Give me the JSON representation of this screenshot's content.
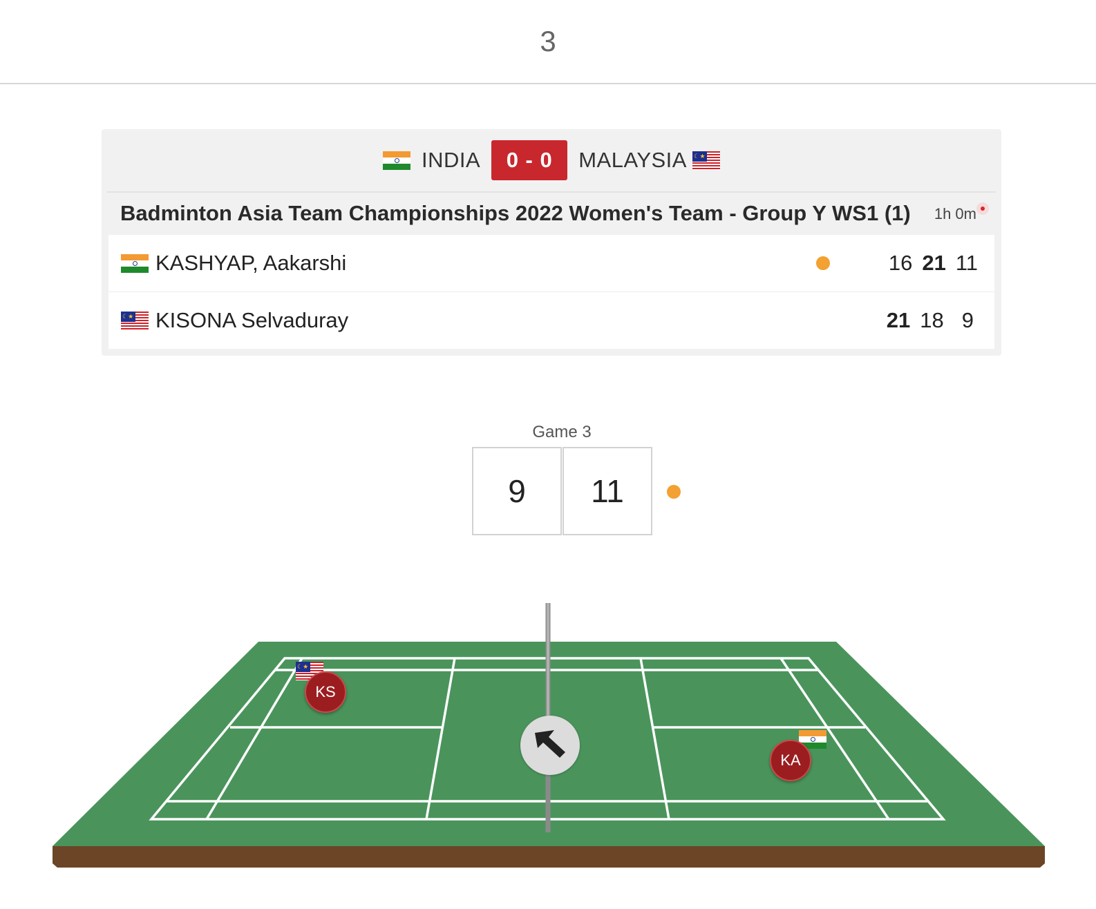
{
  "page": {
    "heading": "3"
  },
  "tie": {
    "team_left": "INDIA",
    "team_right": "MALAYSIA",
    "tie_score": "0 - 0",
    "team_left_flag": "flag-india-icon",
    "team_right_flag": "flag-malaysia-icon"
  },
  "match": {
    "title": "Badminton Asia Team Championships 2022 Women's Team - Group Y WS1 (1)",
    "duration": "1h 0m",
    "live_indicator": "live-dot-icon",
    "players": [
      {
        "name": "KASHYAP, Aakarshi",
        "flag": "flag-india-icon",
        "serving": true,
        "games": [
          "16",
          "21",
          "11"
        ],
        "games_won": [
          false,
          true,
          false
        ]
      },
      {
        "name": "KISONA Selvaduray",
        "flag": "flag-malaysia-icon",
        "serving": false,
        "games": [
          "21",
          "18",
          "9"
        ],
        "games_won": [
          true,
          false,
          false
        ]
      }
    ]
  },
  "current_game": {
    "label": "Game 3",
    "left_score": "9",
    "right_score": "11",
    "serving_side": "right"
  },
  "court": {
    "left_player_initials": "KS",
    "right_player_initials": "KA",
    "left_player_flag": "flag-malaysia-icon",
    "right_player_flag": "flag-india-icon",
    "shuttle_direction_icon": "arrow-up-left-icon",
    "colors": {
      "surface": "#4a945c",
      "base": "#6b4526",
      "lines": "#ffffff",
      "marker": "#9b1d20",
      "serve": "#f2a132",
      "accent_red": "#c8282d"
    }
  }
}
